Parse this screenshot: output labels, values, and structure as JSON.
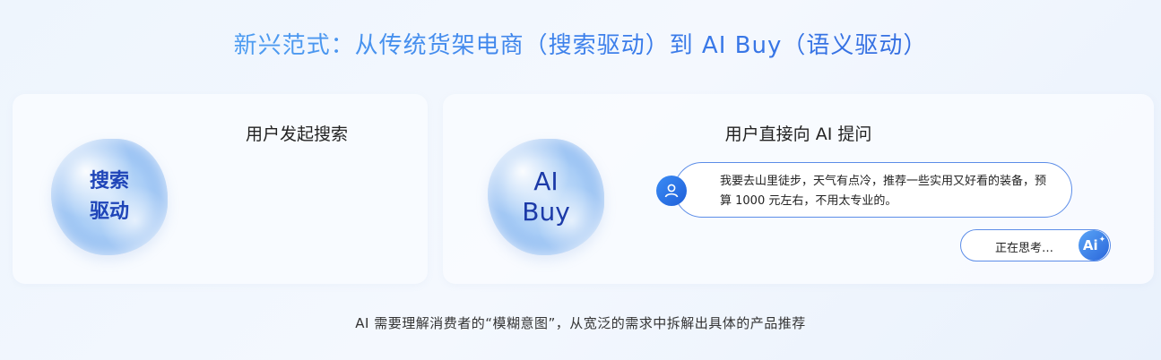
{
  "title": "新兴范式：从传统货架电商（搜索驱动）到 AI Buy（语义驱动）",
  "left_panel": {
    "heading": "用户发起搜索",
    "blob_label": "搜索\n驱动"
  },
  "right_panel": {
    "heading": "用户直接向 AI 提问",
    "blob_label": "AI\nBuy",
    "user_message": "我要去山里徒步，天气有点冷，推荐一些实用又好看的装备，预算 1000 元左右，不用太专业的。",
    "thinking_status": "正在思考…",
    "ai_avatar_label": "Ai",
    "user_avatar_icon": "user-icon",
    "ai_avatar_icon": "sparkle-icon"
  },
  "footer": "AI 需要理解消费者的“模糊意图”，从宽泛的需求中拆解出具体的产品推荐",
  "colors": {
    "accent": "#2f62d9",
    "border": "#5c8de8",
    "background": "#eef5fd"
  }
}
